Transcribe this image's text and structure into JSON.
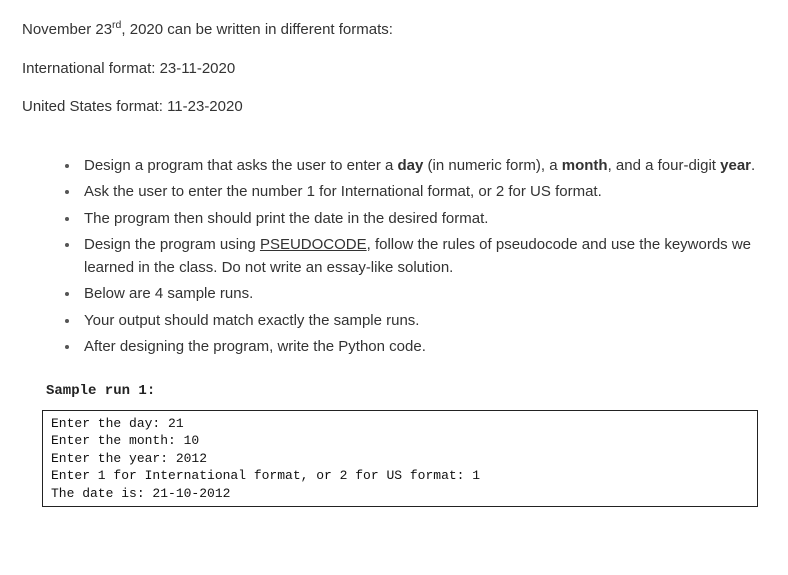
{
  "intro": {
    "line1_pre": "November 23",
    "line1_sup": "rd",
    "line1_post": ", 2020 can be written in different formats:",
    "line2": "International format: 23-11-2020",
    "line3": "United States format: 11-23-2020"
  },
  "bullets": {
    "b1_1": "Design a program that asks the user to enter a ",
    "b1_day": "day",
    "b1_2": " (in numeric form), a ",
    "b1_month": "month",
    "b1_3": ", and a four-digit ",
    "b1_year": "year",
    "b1_4": ".",
    "b2": "Ask the user to enter the number 1 for International format, or 2 for US format.",
    "b3": "The program then should print the date in the desired format.",
    "b4_1": "Design the program using ",
    "b4_pseudo": "PSEUDOCODE",
    "b4_2": ", follow the rules of pseudocode and use the keywords we learned in the class. Do not write an essay-like solution.",
    "b5": "Below are 4 sample runs.",
    "b6": "Your output should match exactly the sample runs.",
    "b7": "After designing the program, write the Python code."
  },
  "sample": {
    "label": "Sample run 1:",
    "lines": {
      "l1": "Enter the day: 21",
      "l2": "Enter the month: 10",
      "l3": "Enter the year: 2012",
      "l4": "Enter 1 for International format, or 2 for US format: 1",
      "l5": "The date is: 21-10-2012"
    }
  }
}
